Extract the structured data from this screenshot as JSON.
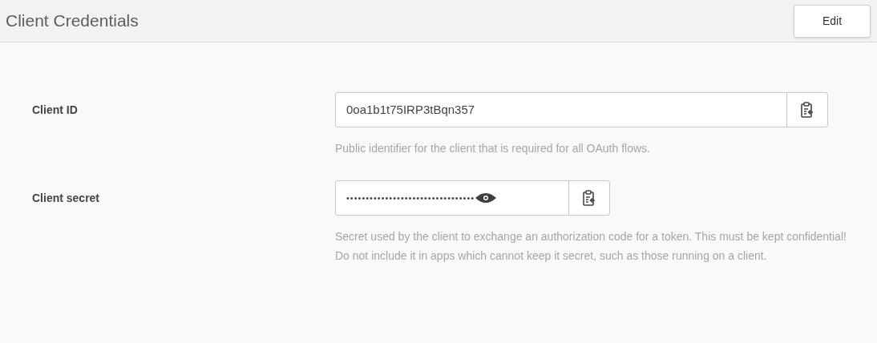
{
  "header": {
    "title": "Client Credentials",
    "edit_button": "Edit"
  },
  "fields": [
    {
      "kind": "plain",
      "label": "Client ID",
      "value": "0oa1b1t75IRP3tBqn357",
      "help": "Public identifier for the client that is required for all OAuth flows."
    },
    {
      "kind": "masked",
      "label": "Client secret",
      "value": "•••••••••••••••••••••••••••••••••",
      "help": "Secret used by the client to exchange an authorization code for a token. This must be kept confidential! Do not include it in apps which cannot keep it secret, such as those running on a client."
    }
  ]
}
